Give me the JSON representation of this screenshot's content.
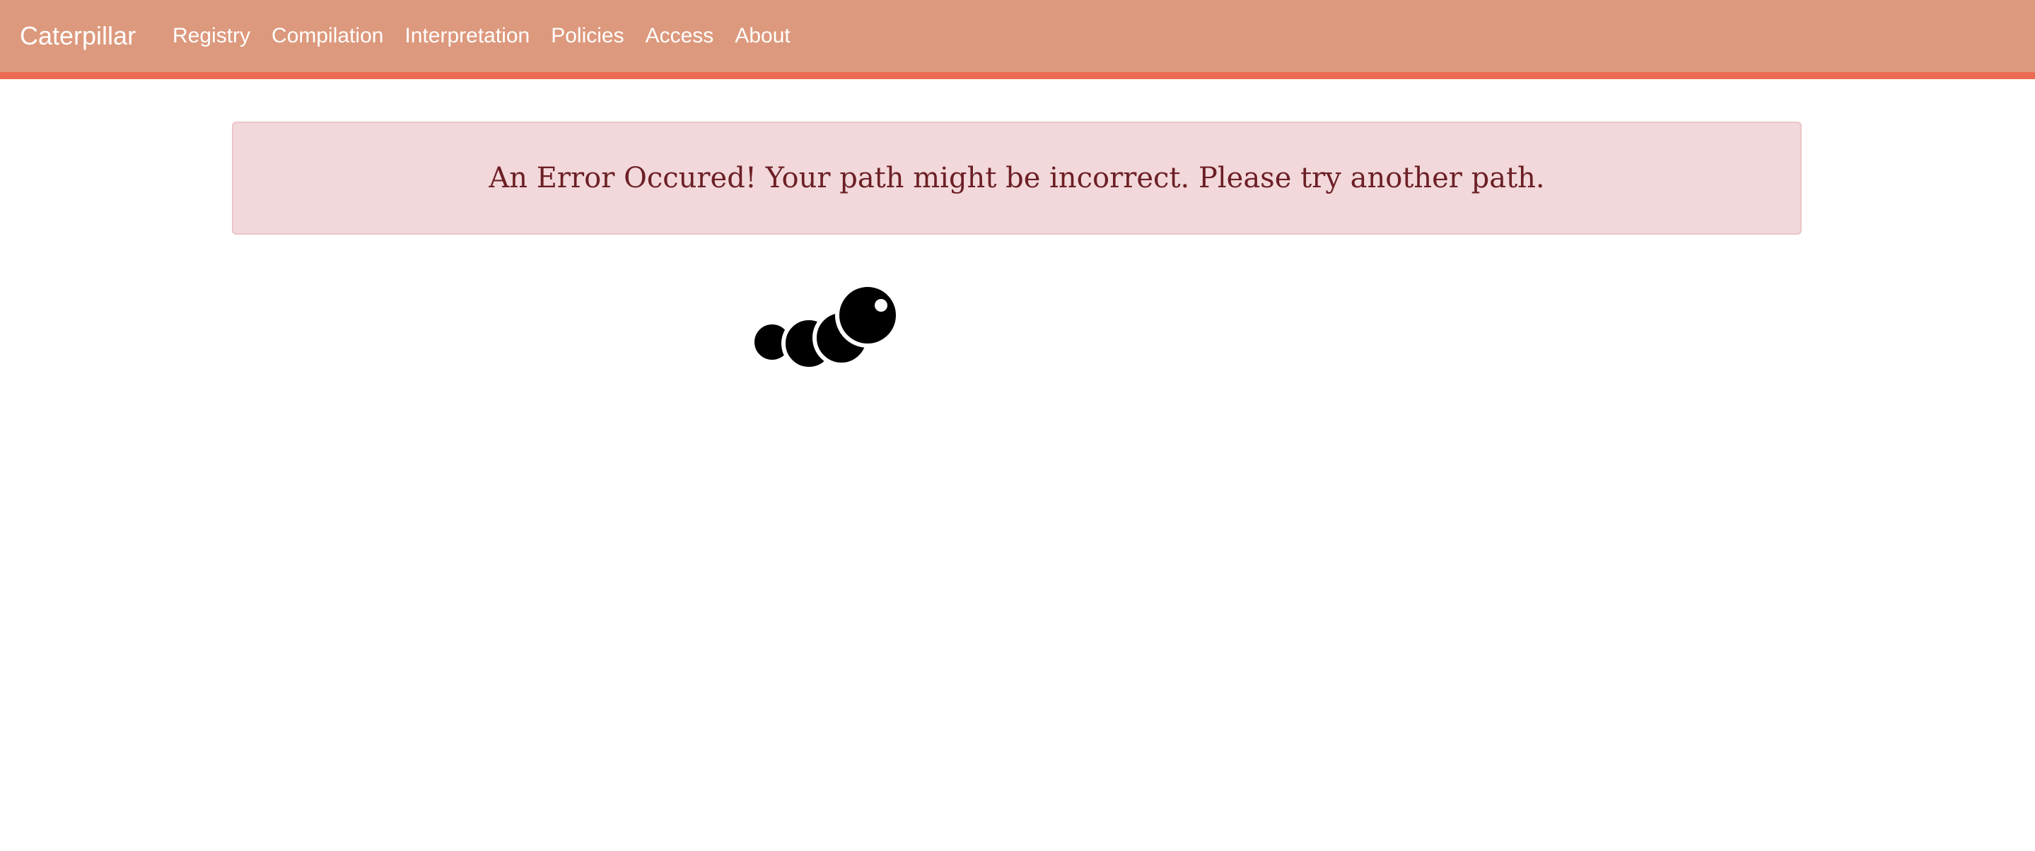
{
  "navbar": {
    "brand": "Caterpillar",
    "links": [
      "Registry",
      "Compilation",
      "Interpretation",
      "Policies",
      "Access",
      "About"
    ]
  },
  "alert": {
    "message": "An Error Occured! Your path might be incorrect. Please try another path."
  },
  "colors": {
    "navbar_bg": "#dd997d",
    "navbar_border": "#ec6b52",
    "alert_bg": "#f2d8da",
    "alert_text": "#6c1f25"
  },
  "icons": {
    "logo": "caterpillar-logo-icon"
  }
}
